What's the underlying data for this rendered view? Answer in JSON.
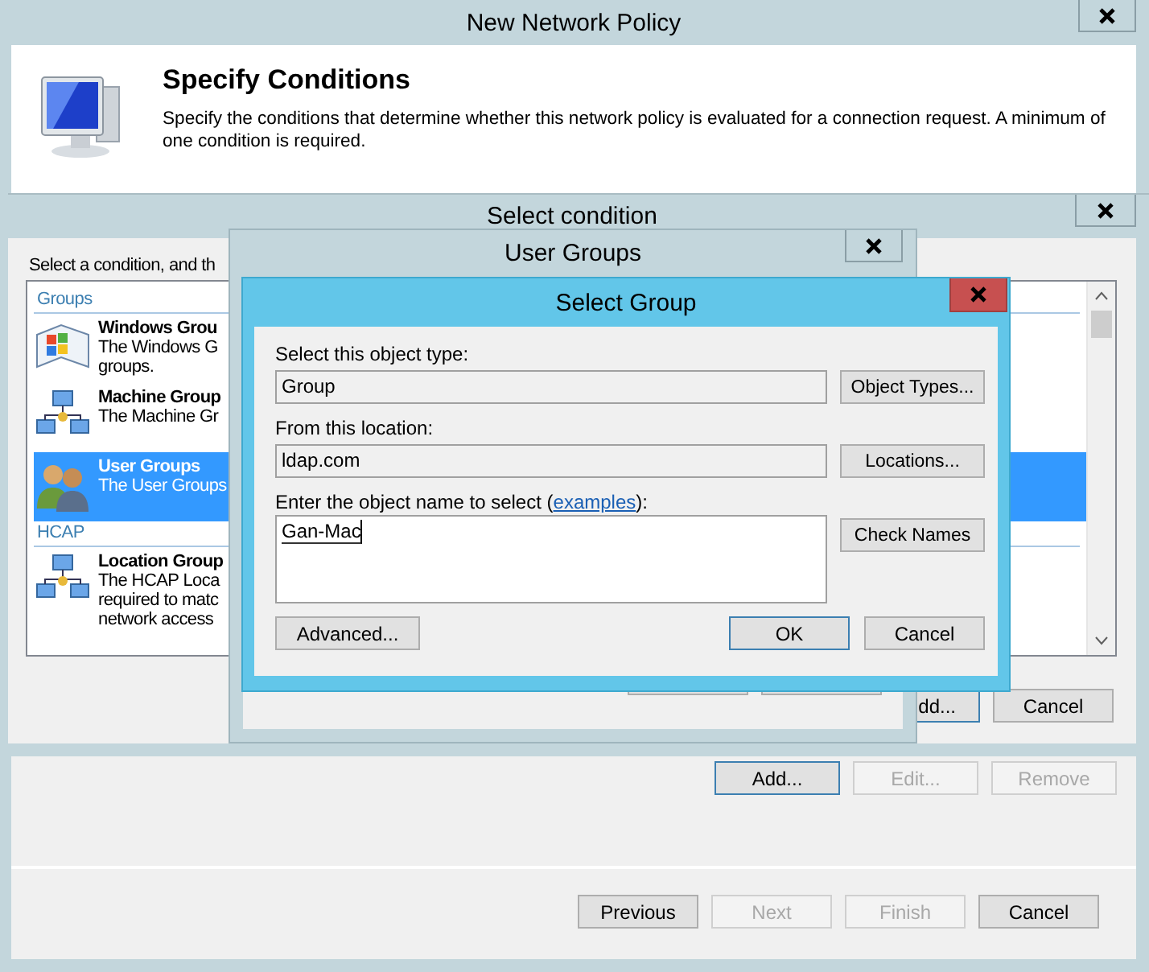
{
  "main_window": {
    "title": "New Network Policy",
    "header": {
      "heading": "Specify Conditions",
      "description": "Specify the conditions that determine whether this network policy is evaluated for a connection request. A minimum of one condition is required."
    },
    "condition_buttons": [
      {
        "label": "Add...",
        "disabled": false,
        "default": true
      },
      {
        "label": "Edit...",
        "disabled": true,
        "default": false
      },
      {
        "label": "Remove",
        "disabled": true,
        "default": false
      }
    ],
    "wizard_buttons": [
      {
        "label": "Previous",
        "disabled": false,
        "default": false
      },
      {
        "label": "Next",
        "disabled": true,
        "default": false
      },
      {
        "label": "Finish",
        "disabled": true,
        "default": false
      },
      {
        "label": "Cancel",
        "disabled": false,
        "default": false
      }
    ]
  },
  "select_condition": {
    "title": "Select condition",
    "instruction": "Select a condition, and th",
    "list": [
      {
        "kind": "header",
        "label": "Groups"
      },
      {
        "kind": "item",
        "name": "Windows Grou",
        "lines": [
          "The Windows G",
          "groups."
        ],
        "selected": false
      },
      {
        "kind": "item",
        "name": "Machine Group",
        "lines": [
          "The Machine Gr"
        ],
        "selected": false
      },
      {
        "kind": "item",
        "name": "User Groups",
        "lines": [
          "The User Groups"
        ],
        "selected": true
      },
      {
        "kind": "header",
        "label": "HCAP"
      },
      {
        "kind": "item",
        "name": "Location Group",
        "lines": [
          "The HCAP Loca",
          "required to matc",
          "network access"
        ],
        "selected": false
      }
    ],
    "buttons": [
      {
        "label": "dd...",
        "default": true
      },
      {
        "label": "Cancel",
        "default": false
      }
    ]
  },
  "user_groups": {
    "title": "User Groups"
  },
  "select_group": {
    "title": "Select Group",
    "object_type": {
      "label": "Select this object type:",
      "value": "Group",
      "button": "Object Types..."
    },
    "location": {
      "label": "From this location:",
      "value": "ldap.com",
      "button": "Locations..."
    },
    "name_entry": {
      "label": "Enter the object name to select (",
      "link": "examples",
      "label_end": "):",
      "value": "Gan-Mac",
      "button": "Check Names"
    },
    "buttons": [
      {
        "label": "Advanced...",
        "default": false
      },
      {
        "label": "OK",
        "default": true
      },
      {
        "label": "Cancel",
        "default": false
      }
    ]
  }
}
